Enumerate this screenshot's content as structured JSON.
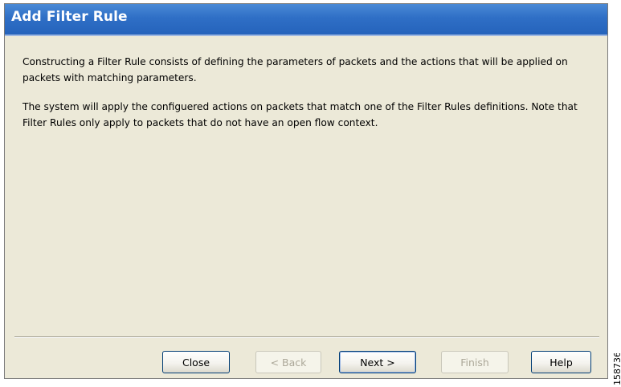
{
  "window": {
    "title": "Add Filter Rule"
  },
  "content": {
    "paragraph_1": "Constructing a Filter Rule consists of defining the parameters of packets and the actions that will be applied on packets with matching parameters.",
    "paragraph_2": "The system will apply the configuered actions on packets that match one of the Filter Rules definitions. Note that Filter Rules only apply to packets that do not have an open flow context."
  },
  "buttons": {
    "close": {
      "label": "Close",
      "enabled": true
    },
    "back": {
      "label": "< Back",
      "enabled": false
    },
    "next": {
      "label": "Next >",
      "enabled": true,
      "focused": true
    },
    "finish": {
      "label": "Finish",
      "enabled": false
    },
    "help": {
      "label": "Help",
      "enabled": true
    }
  },
  "figure_id": "158736",
  "colors": {
    "titlebar": "#2f6fc6",
    "dialog_background": "#ece9d8",
    "button_border": "#003c74",
    "disabled_text": "#aca899"
  }
}
